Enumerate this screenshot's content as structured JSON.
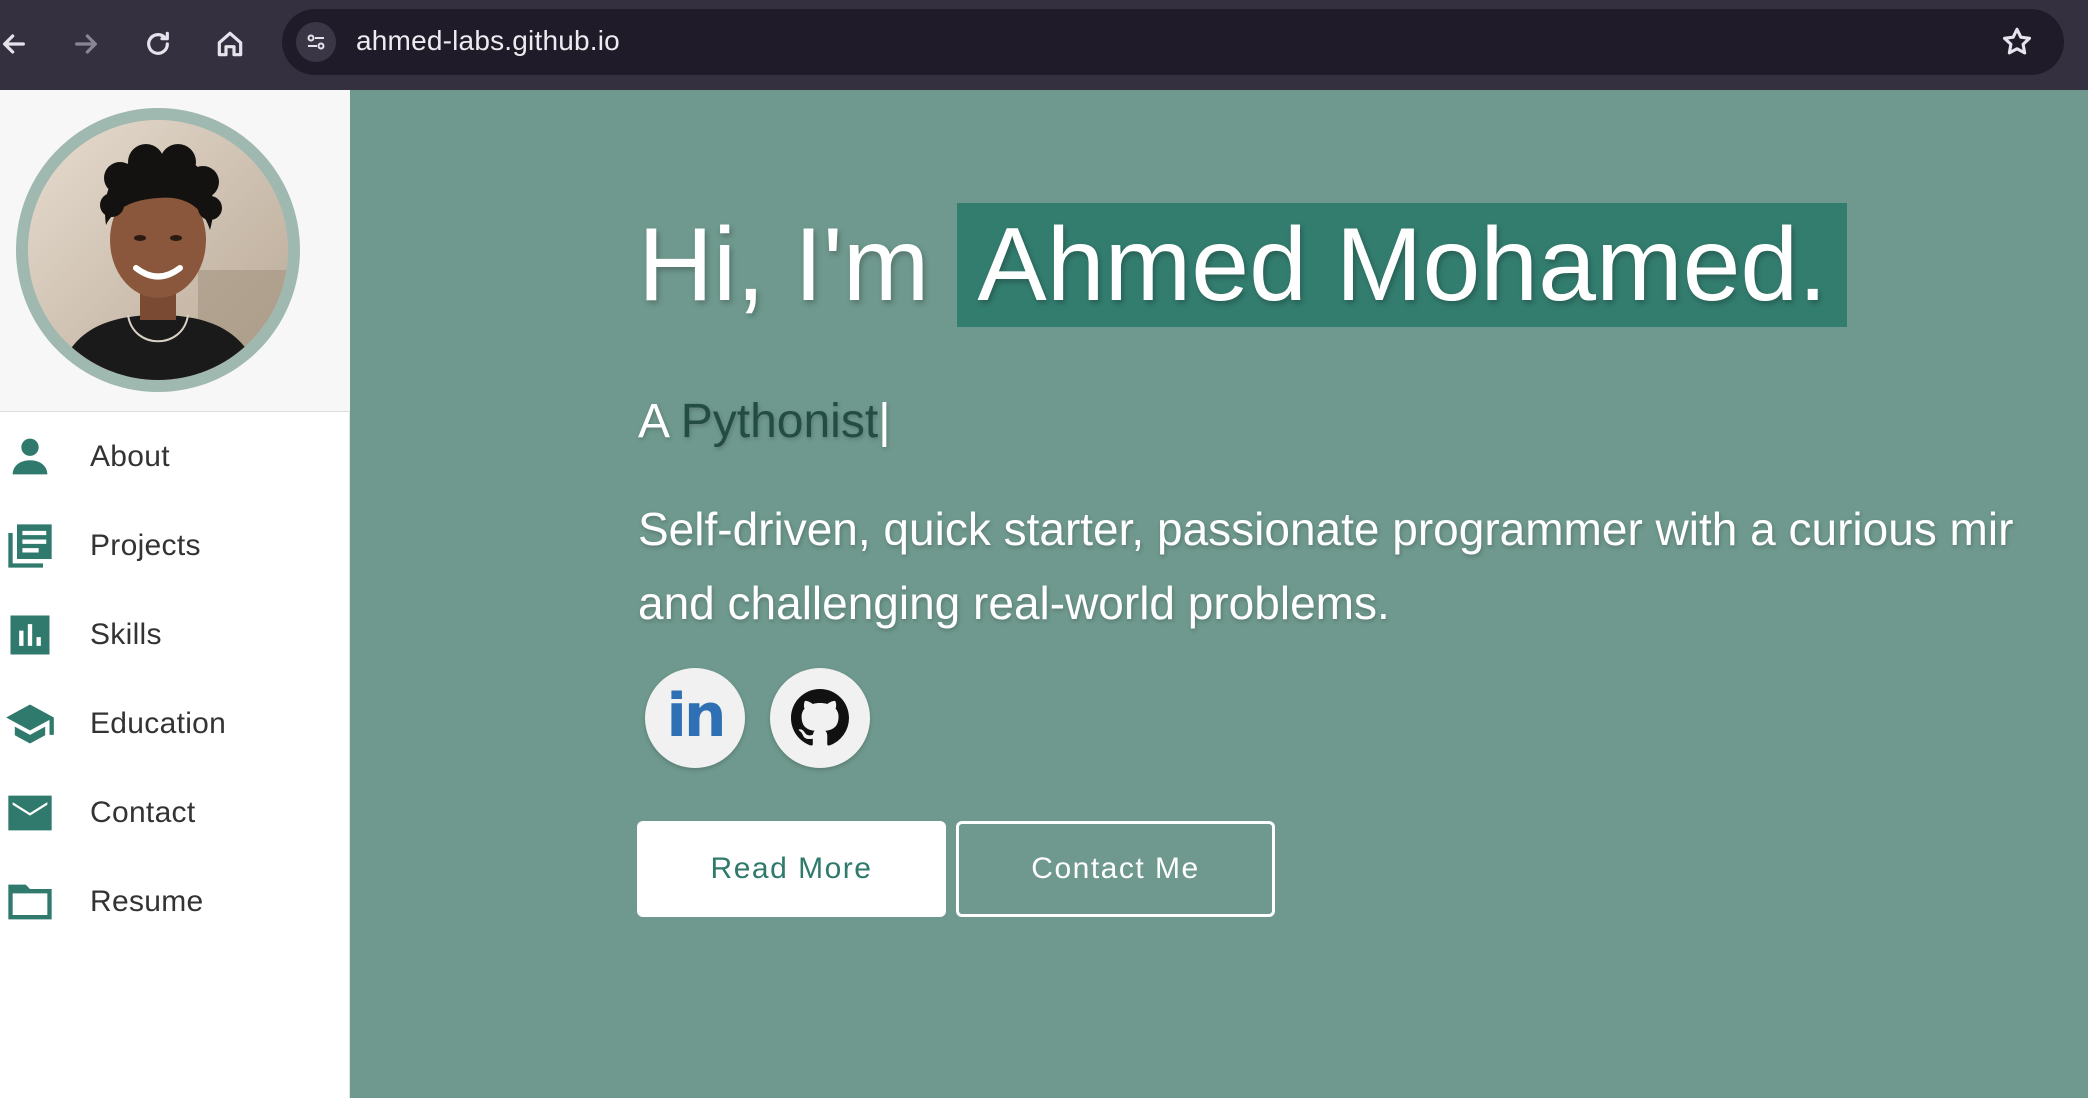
{
  "browser": {
    "url": "ahmed-labs.github.io",
    "icons": [
      "back-icon",
      "forward-icon",
      "reload-icon",
      "home-icon",
      "site-info-icon",
      "bookmark-star-icon"
    ]
  },
  "sidebar": {
    "items": [
      {
        "label": "About",
        "icon": "person-icon"
      },
      {
        "label": "Projects",
        "icon": "projects-icon"
      },
      {
        "label": "Skills",
        "icon": "bar-chart-icon"
      },
      {
        "label": "Education",
        "icon": "graduation-cap-icon"
      },
      {
        "label": "Contact",
        "icon": "envelope-icon"
      },
      {
        "label": "Resume",
        "icon": "folder-icon"
      }
    ]
  },
  "hero": {
    "greeting": "Hi, I'm",
    "name": "Ahmed Mohamed.",
    "subtitle_prefix": "A",
    "subtitle_typed": "Pythonist",
    "caret": "|",
    "description_line1": "Self-driven, quick starter, passionate programmer with a curious mir",
    "description_line2": "and challenging real-world problems.",
    "linkedin_glyph": "in",
    "buttons": {
      "read_more": "Read More",
      "contact_me": "Contact Me"
    }
  },
  "colors": {
    "chrome_bg": "#35303f",
    "omnibox_bg": "#1f1b29",
    "hero_bg": "#6f998e",
    "accent": "#337d6f",
    "icon_green": "#2f7a6c"
  }
}
